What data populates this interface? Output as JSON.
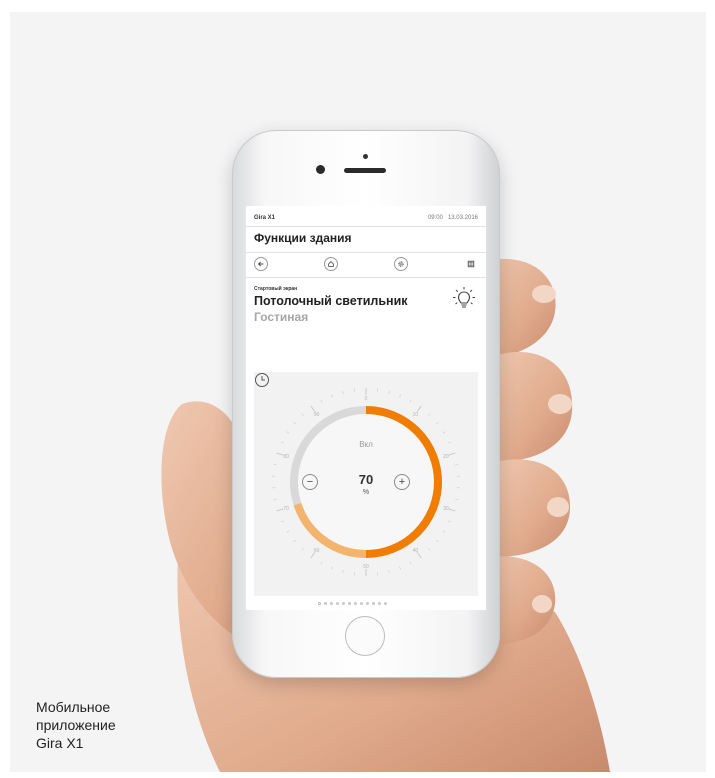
{
  "caption": "Мобильное\nприложение\nGira X1",
  "status_bar": {
    "app_name": "Gira X1",
    "time": "09:00",
    "date": "13.03.2016"
  },
  "page_title": "Функции здания",
  "nav": {
    "items": [
      {
        "name": "back",
        "icon": "arrow-left-icon"
      },
      {
        "name": "home",
        "icon": "home-icon"
      },
      {
        "name": "settings",
        "icon": "gear-icon"
      },
      {
        "name": "grid",
        "icon": "grid-icon"
      }
    ]
  },
  "device": {
    "screen_label": "Стартовый экран",
    "name": "Потолочный светильник",
    "room": "Гостиная",
    "icon": "light-bulb-icon"
  },
  "dimmer": {
    "state_label": "Вкл",
    "value": "70",
    "unit": "%",
    "level_percent": 70,
    "minus_label": "−",
    "plus_label": "+",
    "scale_labels": [
      "0",
      "10",
      "20",
      "30",
      "40",
      "50",
      "60",
      "70",
      "80",
      "90"
    ],
    "accent_color": "#f07d00",
    "accent_light": "#f3b46d",
    "track_color": "#d9d9d9"
  },
  "pager": {
    "count": 12,
    "active": 0
  }
}
